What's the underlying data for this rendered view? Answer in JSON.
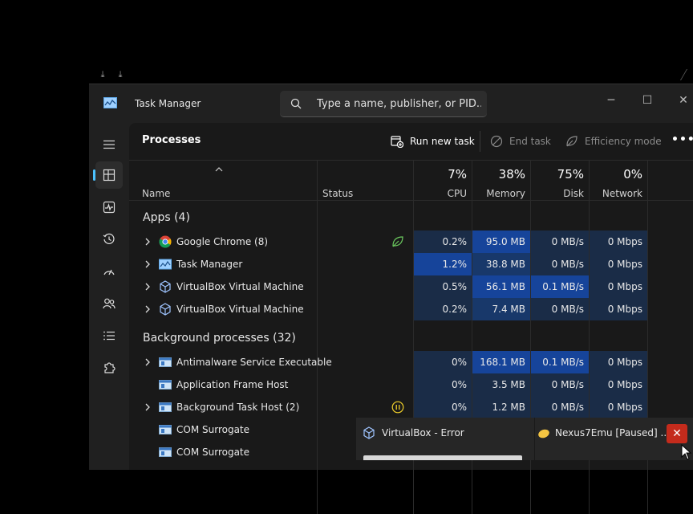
{
  "window": {
    "title": "Task Manager"
  },
  "search": {
    "placeholder": "Type a name, publisher, or PID..."
  },
  "toolbar": {
    "title": "Processes",
    "run_new_task": "Run new task",
    "end_task": "End task",
    "efficiency_mode": "Efficiency mode"
  },
  "columns": {
    "name": "Name",
    "status": "Status",
    "cpu": {
      "pct": "7%",
      "label": "CPU"
    },
    "memory": {
      "pct": "38%",
      "label": "Memory"
    },
    "disk": {
      "pct": "75%",
      "label": "Disk"
    },
    "network": {
      "pct": "0%",
      "label": "Network"
    }
  },
  "sections": {
    "apps": "Apps (4)",
    "background": "Background processes (32)"
  },
  "processes": [
    {
      "name": "Google Chrome (8)",
      "cpu": "0.2%",
      "memory": "95.0 MB",
      "disk": "0 MB/s",
      "network": "0 Mbps",
      "icon": "chrome-icon",
      "status_icon": "efficiency-leaf-icon"
    },
    {
      "name": "Task Manager",
      "cpu": "1.2%",
      "memory": "38.8 MB",
      "disk": "0 MB/s",
      "network": "0 Mbps",
      "icon": "task-manager-icon"
    },
    {
      "name": "VirtualBox Virtual Machine",
      "cpu": "0.5%",
      "memory": "56.1 MB",
      "disk": "0.1 MB/s",
      "network": "0 Mbps",
      "icon": "virtualbox-icon"
    },
    {
      "name": "VirtualBox Virtual Machine",
      "cpu": "0.2%",
      "memory": "7.4 MB",
      "disk": "0 MB/s",
      "network": "0 Mbps",
      "icon": "virtualbox-icon"
    },
    {
      "name": "Antimalware Service Executable",
      "cpu": "0%",
      "memory": "168.1 MB",
      "disk": "0.1 MB/s",
      "network": "0 Mbps",
      "icon": "service-icon"
    },
    {
      "name": "Application Frame Host",
      "cpu": "0%",
      "memory": "3.5 MB",
      "disk": "0 MB/s",
      "network": "0 Mbps",
      "icon": "service-icon"
    },
    {
      "name": "Background Task Host (2)",
      "cpu": "0%",
      "memory": "1.2 MB",
      "disk": "0 MB/s",
      "network": "0 Mbps",
      "icon": "service-icon",
      "status_icon": "suspended-pause-icon"
    },
    {
      "name": "COM Surrogate",
      "icon": "service-icon"
    },
    {
      "name": "COM Surrogate",
      "icon": "service-icon"
    }
  ],
  "taskbar_popup": {
    "item1": "VirtualBox - Error",
    "item2": "Nexus7Emu [Paused] ...",
    "close": "✕"
  },
  "colors": {
    "heat_low": "#1a2c47",
    "heat_mid": "#18386a",
    "heat_high": "#16449a",
    "accent": "#4cc2ff"
  }
}
